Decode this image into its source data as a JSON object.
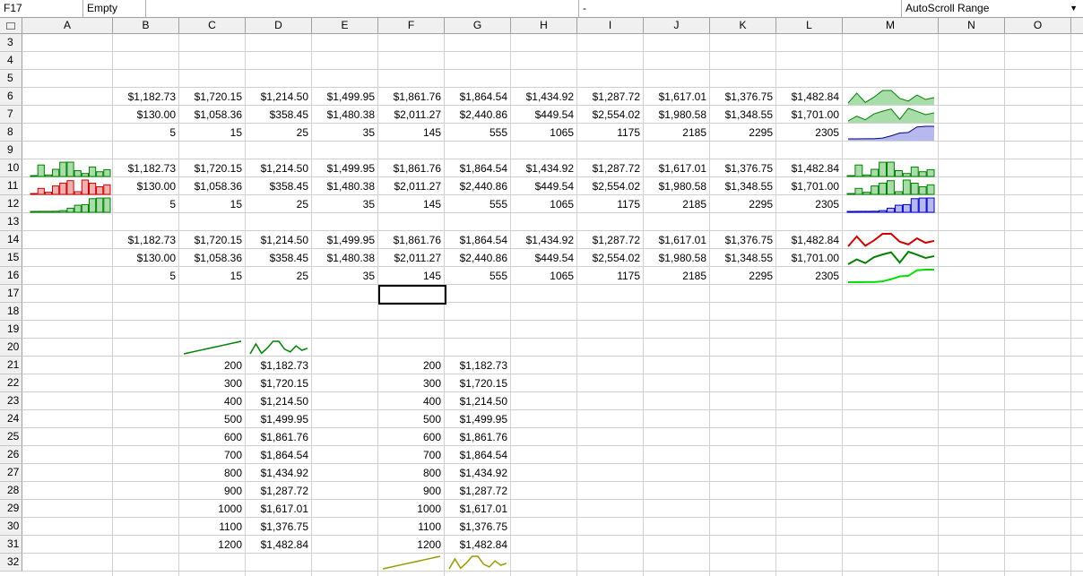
{
  "formula_bar": {
    "cell_ref": "F17",
    "cell_type": "Empty",
    "separator": "-",
    "autoscroll_label": "AutoScroll Range"
  },
  "columns": [
    "A",
    "B",
    "C",
    "D",
    "E",
    "F",
    "G",
    "H",
    "I",
    "J",
    "K",
    "L",
    "M",
    "N",
    "O"
  ],
  "row_numbers": [
    "3",
    "4",
    "5",
    "6",
    "7",
    "8",
    "9",
    "10",
    "11",
    "12",
    "13",
    "14",
    "15",
    "16",
    "17",
    "18",
    "19",
    "20",
    "21",
    "22",
    "23",
    "24",
    "25",
    "26",
    "27",
    "28",
    "29",
    "30",
    "31",
    "32"
  ],
  "block_rows": [
    [
      "$1,182.73",
      "$1,720.15",
      "$1,214.50",
      "$1,499.95",
      "$1,861.76",
      "$1,864.54",
      "$1,434.92",
      "$1,287.72",
      "$1,617.01",
      "$1,376.75",
      "$1,482.84"
    ],
    [
      "$130.00",
      "$1,058.36",
      "$358.45",
      "$1,480.38",
      "$2,011.27",
      "$2,440.86",
      "$449.54",
      "$2,554.02",
      "$1,980.58",
      "$1,348.55",
      "$1,701.00"
    ],
    [
      "5",
      "15",
      "25",
      "35",
      "145",
      "555",
      "1065",
      "1175",
      "2185",
      "2295",
      "2305"
    ]
  ],
  "vertical_x": [
    "200",
    "300",
    "400",
    "500",
    "600",
    "700",
    "800",
    "900",
    "1000",
    "1100",
    "1200"
  ],
  "vertical_y": [
    "$1,182.73",
    "$1,720.15",
    "$1,214.50",
    "$1,499.95",
    "$1,861.76",
    "$1,864.54",
    "$1,434.92",
    "$1,287.72",
    "$1,617.01",
    "$1,376.75",
    "$1,482.84"
  ],
  "spark_values": {
    "s1": [
      1182.73,
      1720.15,
      1214.5,
      1499.95,
      1861.76,
      1864.54,
      1434.92,
      1287.72,
      1617.01,
      1376.75,
      1482.84
    ],
    "s2": [
      130.0,
      1058.36,
      358.45,
      1480.38,
      2011.27,
      2440.86,
      449.54,
      2554.02,
      1980.58,
      1348.55,
      1701.0
    ],
    "s3": [
      5,
      15,
      25,
      35,
      145,
      555,
      1065,
      1175,
      2185,
      2295,
      2305
    ]
  },
  "colors": {
    "green": "#008000",
    "green_fill": "#a8dca8",
    "red": "#cc0000",
    "red_fill": "#f0b0b0",
    "blue": "#0000cc",
    "blue_fill": "#b8b8f0",
    "navy": "#000080",
    "lime": "#00e000",
    "olive": "#999900"
  }
}
